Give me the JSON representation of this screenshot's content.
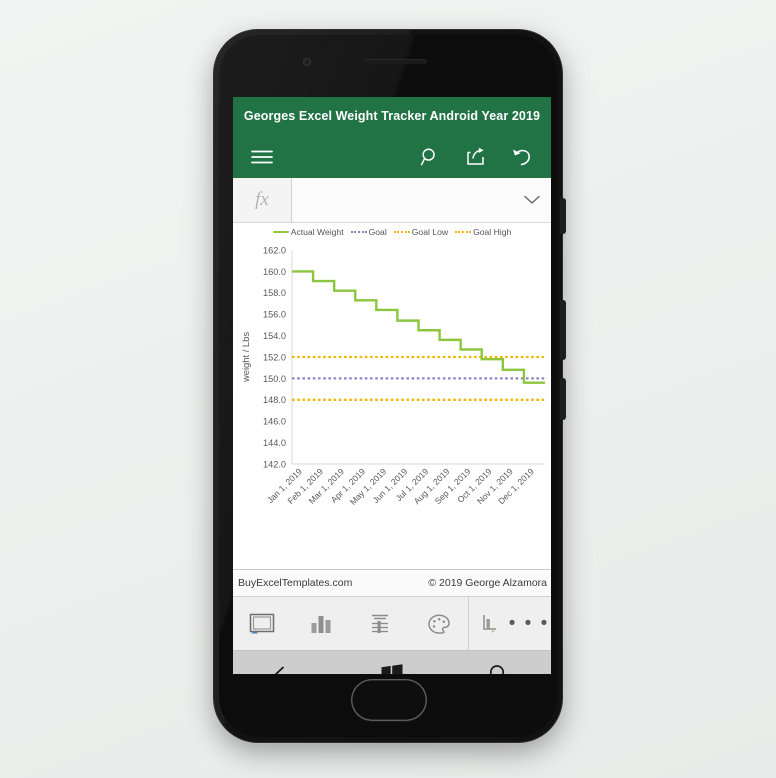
{
  "app": {
    "title": "Georges Excel Weight Tracker Android Year 2019",
    "header_color": "#217346",
    "icons": {
      "menu": "hamburger-menu-icon",
      "search": "search-icon",
      "share": "share-icon",
      "undo": "undo-icon"
    }
  },
  "formula_bar": {
    "fx_label": "fx",
    "value": "",
    "placeholder": "",
    "expand_icon": "chevron-down-icon"
  },
  "status_bar": {
    "left": "BuyExcelTemplates.com",
    "right": "© 2019 George Alzamora"
  },
  "bottom_toolbar": {
    "items": [
      {
        "name": "chart-area-button",
        "icon": "chart-area-icon"
      },
      {
        "name": "chart-type-button",
        "icon": "bar-chart-icon"
      },
      {
        "name": "chart-layout-button",
        "icon": "chart-layout-icon"
      },
      {
        "name": "chart-colors-button",
        "icon": "palette-icon"
      },
      {
        "name": "chart-format-button",
        "icon": "chart-format-icon"
      }
    ],
    "more_label": "• • •"
  },
  "nav_bar": {
    "back_label": "back-arrow-icon",
    "home_label": "windows-logo-icon",
    "search_label": "search-icon"
  },
  "chart_data": {
    "type": "line",
    "title": "",
    "xlabel": "",
    "ylabel": "weight / Lbs",
    "ylim": [
      142.0,
      162.0
    ],
    "ytick_step": 2.0,
    "yticks": [
      "162.0",
      "160.0",
      "158.0",
      "156.0",
      "154.0",
      "152.0",
      "150.0",
      "148.0",
      "146.0",
      "144.0",
      "142.0"
    ],
    "categories": [
      "Jan 1, 2019",
      "Feb 1, 2019",
      "Mar 1, 2019",
      "Apr 1, 2019",
      "May 1, 2019",
      "Jun 1, 2019",
      "Jul 1, 2019",
      "Aug 1, 2019",
      "Sep 1, 2019",
      "Oct 1, 2019",
      "Nov 1, 2019",
      "Dec 1, 2019"
    ],
    "grid": false,
    "legend_position": "top",
    "interpolation": "step",
    "series": [
      {
        "name": "Actual Weight",
        "color": "#8CC63E",
        "style": "solid",
        "values": [
          160.0,
          159.1,
          158.2,
          157.3,
          156.4,
          155.4,
          154.5,
          153.6,
          152.7,
          151.8,
          150.8,
          149.6
        ]
      },
      {
        "name": "Goal",
        "color": "#8A86C0",
        "style": "dotted",
        "constant": 150.0,
        "values": [
          150.0,
          150.0,
          150.0,
          150.0,
          150.0,
          150.0,
          150.0,
          150.0,
          150.0,
          150.0,
          150.0,
          150.0
        ]
      },
      {
        "name": "Goal Low",
        "color": "#F2B705",
        "style": "dotted",
        "constant": 148.0,
        "values": [
          148.0,
          148.0,
          148.0,
          148.0,
          148.0,
          148.0,
          148.0,
          148.0,
          148.0,
          148.0,
          148.0,
          148.0
        ]
      },
      {
        "name": "Goal High",
        "color": "#F2B705",
        "style": "dotted",
        "constant": 152.0,
        "values": [
          152.0,
          152.0,
          152.0,
          152.0,
          152.0,
          152.0,
          152.0,
          152.0,
          152.0,
          152.0,
          152.0,
          152.0
        ]
      }
    ]
  }
}
